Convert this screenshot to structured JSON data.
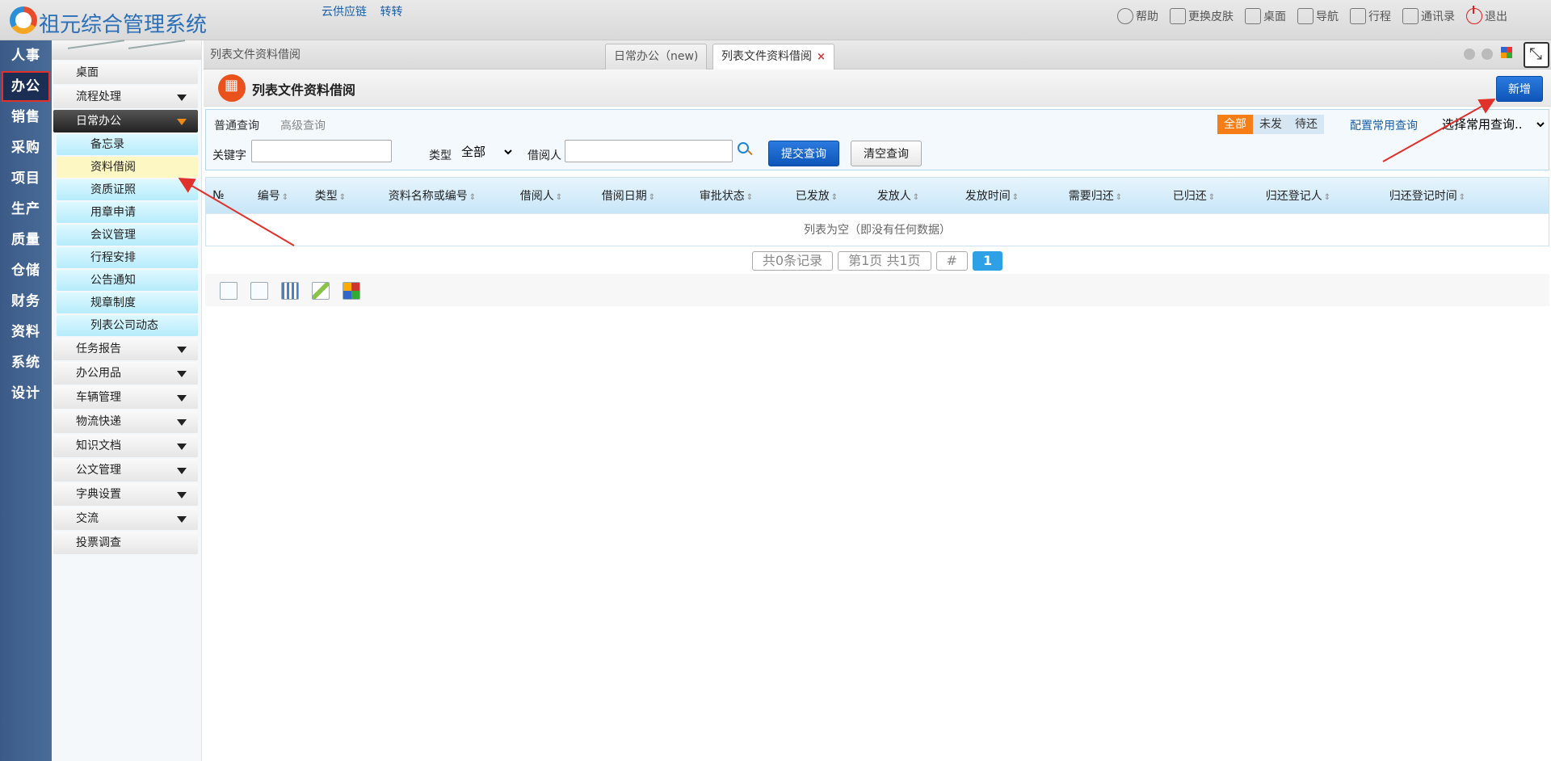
{
  "header": {
    "app_title": "祖元综合管理系统",
    "top_links": [
      "云供应链",
      "转转"
    ],
    "actions": [
      {
        "label": "帮助",
        "icon": "help-icon"
      },
      {
        "label": "更换皮肤",
        "icon": "shirt-icon"
      },
      {
        "label": "桌面",
        "icon": "home-icon"
      },
      {
        "label": "导航",
        "icon": "grid-nav-icon"
      },
      {
        "label": "行程",
        "icon": "calendar-icon"
      },
      {
        "label": "通讯录",
        "icon": "contacts-icon"
      },
      {
        "label": "退出",
        "icon": "power-icon"
      }
    ]
  },
  "rail": {
    "items": [
      "人事",
      "办公",
      "销售",
      "采购",
      "项目",
      "生产",
      "质量",
      "仓储",
      "财务",
      "资料",
      "系统",
      "设计"
    ],
    "active": "办公"
  },
  "menu": {
    "desktop": "桌面",
    "workflow": "流程处理",
    "daily_office": "日常办公",
    "sub_items": [
      "备忘录",
      "资料借阅",
      "资质证照",
      "用章申请",
      "会议管理",
      "行程安排",
      "公告通知",
      "规章制度",
      "列表公司动态"
    ],
    "active_sub": "资料借阅",
    "groups": [
      "任务报告",
      "办公用品",
      "车辆管理",
      "物流快递",
      "知识文档",
      "公文管理",
      "字典设置",
      "交流"
    ],
    "vote": "投票调查"
  },
  "tabs": {
    "breadcrumb": "列表文件资料借阅",
    "items": [
      {
        "label": "日常办公（new)"
      },
      {
        "label": "列表文件资料借阅",
        "closable": "×"
      }
    ]
  },
  "page": {
    "title": "列表文件资料借阅",
    "add_label": "新增"
  },
  "query": {
    "normal_tab": "普通查询",
    "advanced_tab": "高级查询",
    "filters": [
      "全部",
      "未发",
      "待还"
    ],
    "active_filter": "全部",
    "config_link": "配置常用查询",
    "common_select": "选择常用查询..",
    "keyword_label": "关键字",
    "keyword_value": "",
    "type_label": "类型",
    "type_value": "全部",
    "borrower_label": "借阅人",
    "borrower_value": "",
    "submit_label": "提交查询",
    "clear_label": "清空查询"
  },
  "grid": {
    "columns": [
      "№",
      "编号",
      "类型",
      "资料名称或编号",
      "借阅人",
      "借阅日期",
      "审批状态",
      "已发放",
      "发放人",
      "发放时间",
      "需要归还",
      "已归还",
      "归还登记人",
      "归还登记时间"
    ],
    "sort_glyph": "⇕",
    "empty_text": "列表为空（即没有任何数据）"
  },
  "pager": {
    "total": "共0条记录",
    "pages": "第1页 共1页",
    "jump": "#",
    "current": "1"
  },
  "colors": {
    "accent": "#0e55b9",
    "filter_active": "#f77d17",
    "rail_bg": "#3b5a87",
    "annotation": "#e0312a"
  }
}
